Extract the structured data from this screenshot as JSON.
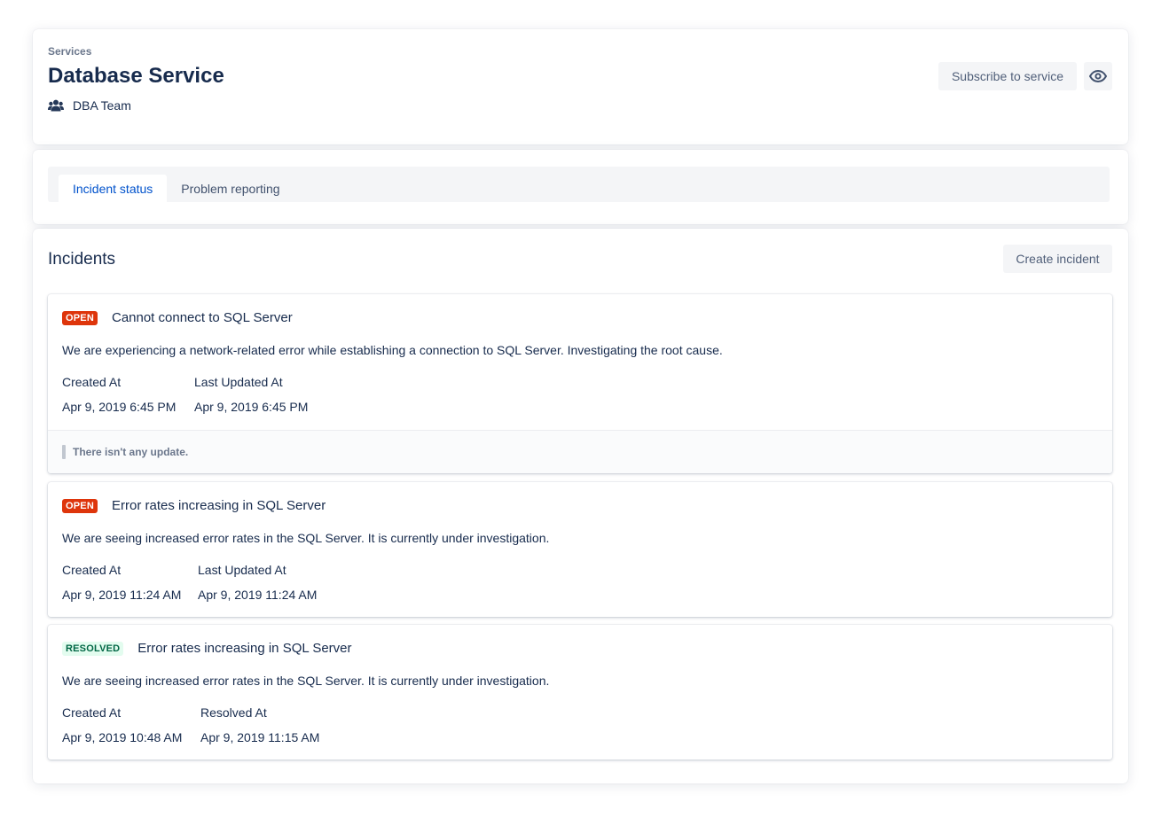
{
  "header": {
    "breadcrumb": "Services",
    "title": "Database Service",
    "team": "DBA Team",
    "team_icon": "people-icon",
    "subscribe_label": "Subscribe to service",
    "watch_icon": "eye-icon"
  },
  "tabs": [
    {
      "label": "Incident status",
      "active": true
    },
    {
      "label": "Problem reporting",
      "active": false
    }
  ],
  "incidents_section": {
    "title": "Incidents",
    "create_label": "Create incident"
  },
  "incidents": [
    {
      "status": "OPEN",
      "title": "Cannot connect to SQL Server",
      "description": "We are experiencing a network-related error while establishing a connection to SQL Server. Investigating the root cause.",
      "label_1": "Created At",
      "value_1": "Apr 9, 2019 6:45 PM",
      "label_2": "Last Updated At",
      "value_2": "Apr 9, 2019 6:45 PM",
      "update_note": "There isn't any update."
    },
    {
      "status": "OPEN",
      "title": "Error rates increasing in SQL Server",
      "description": "We are seeing increased error rates in the SQL Server. It is currently under investigation.",
      "label_1": "Created At",
      "value_1": "Apr 9, 2019 11:24 AM",
      "label_2": "Last Updated At",
      "value_2": "Apr 9, 2019 11:24 AM"
    },
    {
      "status": "RESOLVED",
      "title": "Error rates increasing in SQL Server",
      "description": "We are seeing increased error rates in the SQL Server. It is currently under investigation.",
      "label_1": "Created At",
      "value_1": "Apr 9, 2019 10:48 AM",
      "label_2": "Resolved At",
      "value_2": "Apr 9, 2019 11:15 AM"
    }
  ],
  "colors": {
    "open": "#de350b",
    "resolved_bg": "#e3fcef",
    "resolved_text": "#006644",
    "active_tab": "#0052cc"
  }
}
